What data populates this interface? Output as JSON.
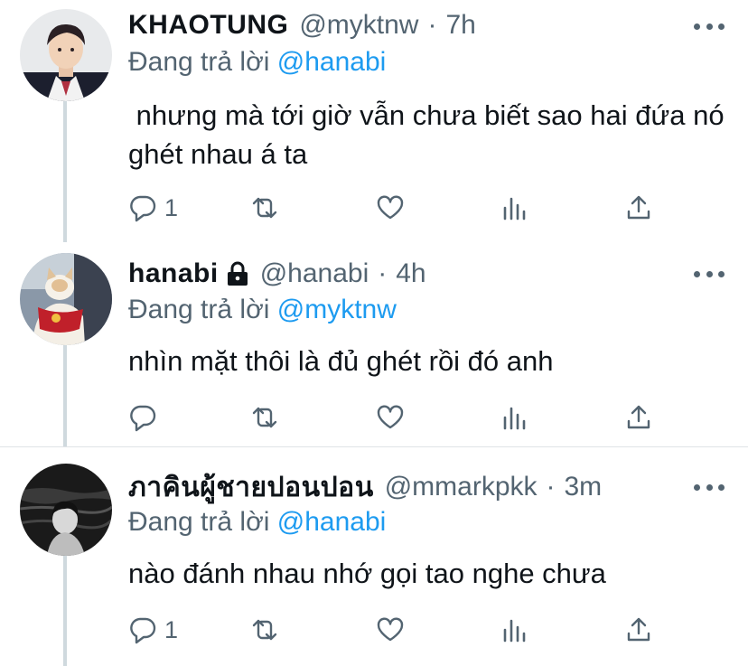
{
  "colors": {
    "accent": "#1d9bf0",
    "secondary_text": "#536471",
    "primary_text": "#0f1419",
    "thread_line": "#cfd9de"
  },
  "replying_label": "Đang trả lời",
  "tweets": [
    {
      "name": "KHAOTUNG",
      "handle": "@myktnw",
      "separator": "·",
      "time": "7h",
      "reply_to": "@hanabi",
      "text": " nhưng mà tới giờ vẫn chưa biết sao hai đứa nó ghét nhau á ta",
      "reply_count": "1",
      "locked": false,
      "icons": [
        "reply-icon",
        "retweet-icon",
        "like-icon",
        "analytics-icon",
        "share-icon"
      ]
    },
    {
      "name": "hanabi",
      "handle": "@hanabi",
      "separator": "·",
      "time": "4h",
      "reply_to": "@myktnw",
      "text": "nhìn mặt thôi là đủ ghét rồi đó anh",
      "reply_count": "",
      "locked": true,
      "icons": [
        "reply-icon",
        "retweet-icon",
        "like-icon",
        "analytics-icon",
        "share-icon"
      ]
    },
    {
      "name": "ภาคินผู้ชายปอนปอน",
      "handle": "@mmarkpkk",
      "separator": "·",
      "time": "3m",
      "reply_to": "@hanabi",
      "text": "nào đánh nhau nhớ gọi tao nghe chưa",
      "reply_count": "1",
      "locked": false,
      "icons": [
        "reply-icon",
        "retweet-icon",
        "like-icon",
        "analytics-icon",
        "share-icon"
      ]
    }
  ]
}
